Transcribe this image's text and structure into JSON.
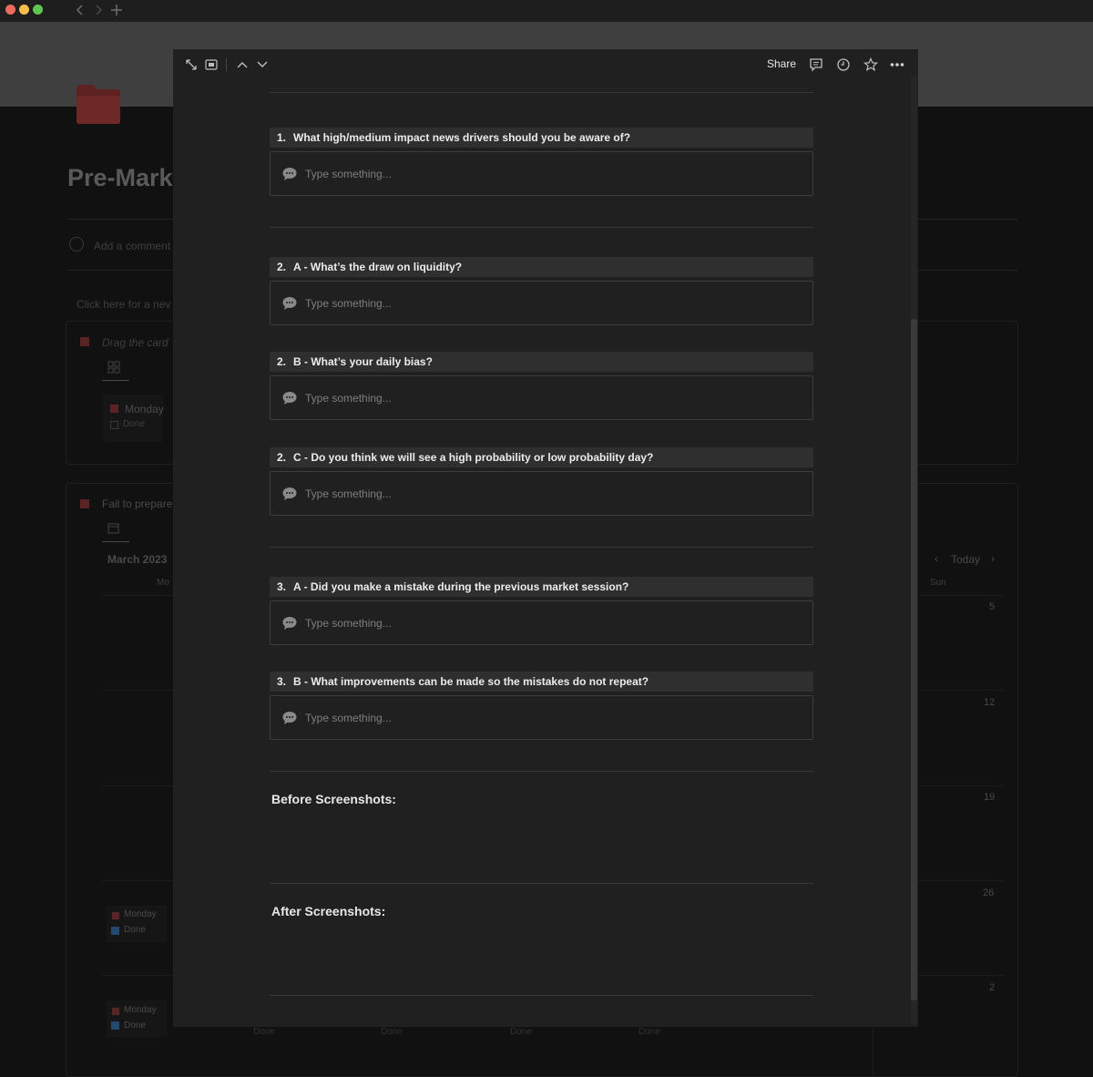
{
  "window": {
    "back_icon": "chevron-left-icon",
    "forward_icon": "chevron-right-icon",
    "new_tab_icon": "plus-icon"
  },
  "background_page": {
    "title": "Pre-Mark",
    "comment_placeholder": "Add a comment",
    "hint_text": "Click here for a nev",
    "section1_label": "Drag the card",
    "card_day": "Monday",
    "card_status": "Done",
    "section2_label": "Fail to prepare",
    "month_label": "March 2023",
    "weekday_mon": "Mo",
    "weekday_sun": "Sun",
    "today_label": "Today",
    "day_numbers": [
      "5",
      "12",
      "19",
      "26",
      "2"
    ],
    "bottom_cards": [
      {
        "day": "Monday",
        "status": "Done"
      },
      {
        "day": "Monday",
        "status": "Done"
      }
    ],
    "bottom_partial": [
      "Done",
      "Done",
      "Done",
      "Done"
    ]
  },
  "modal": {
    "header": {
      "share_label": "Share",
      "icons": [
        "expand-icon",
        "peek-mode-icon",
        "chevron-up-icon",
        "chevron-down-icon",
        "comment-icon",
        "history-icon",
        "star-icon",
        "more-icon"
      ]
    },
    "placeholder": "Type something...",
    "questions": [
      {
        "num": "1.",
        "text": "What high/medium impact news drivers should you be aware of?"
      },
      {
        "num": "2.",
        "text": "A - What’s the draw on liquidity?"
      },
      {
        "num": "2.",
        "text": "B - What’s your daily bias?"
      },
      {
        "num": "2.",
        "text": "C - Do you think we will see a high probability or low probability day?"
      },
      {
        "num": "3.",
        "text": "A - Did you make a mistake during the previous market session?"
      },
      {
        "num": "3.",
        "text": "B - What improvements can be made so the mistakes do not repeat?"
      }
    ],
    "before_screenshots": "Before Screenshots:",
    "after_screenshots": "After Screenshots:"
  },
  "colors": {
    "modal_bg": "#202020",
    "question_bg": "#2f2f2f",
    "accent_red": "#7a2a2a"
  }
}
